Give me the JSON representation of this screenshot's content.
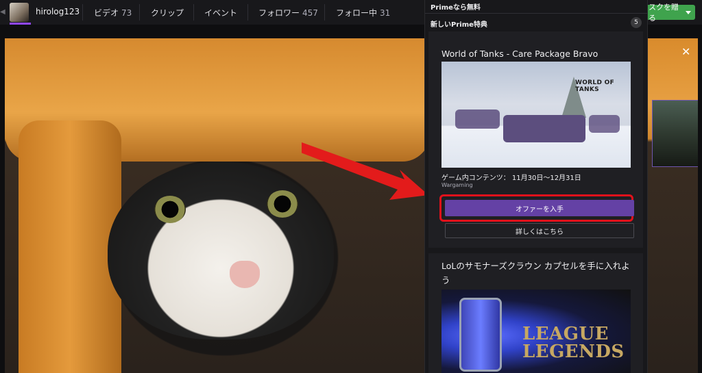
{
  "channel": {
    "username": "hirolog123",
    "tabs": [
      {
        "label": "ビデオ",
        "count": "73"
      },
      {
        "label": "クリップ",
        "count": ""
      },
      {
        "label": "イベント",
        "count": ""
      },
      {
        "label": "フォロワー",
        "count": "457"
      },
      {
        "label": "フォロー中",
        "count": "31"
      }
    ],
    "gift_button_label": "スクを贈る"
  },
  "prime_dropdown": {
    "header": "Primeなら無料",
    "section_title": "新しいPrime特典",
    "badge_count": "5",
    "offers": [
      {
        "title": "World of Tanks - Care Package Bravo",
        "image_logo_text": "WORLD OF TANKS",
        "meta": "ゲーム内コンテンツ： 11月30日〜12月31日",
        "publisher": "Wargaming",
        "primary_button": "オファーを入手",
        "secondary_button": "詳しくはこちら"
      },
      {
        "title": "LoLのサモナーズクラウン カプセルを手に入れよう",
        "image_logo_text": "LEAGUE OF LEGENDS"
      }
    ]
  },
  "overlay": {
    "close_glyph": "✕"
  },
  "colors": {
    "accent": "#6441a5",
    "highlight": "#e3111b",
    "gift_green": "#3fa34d"
  }
}
